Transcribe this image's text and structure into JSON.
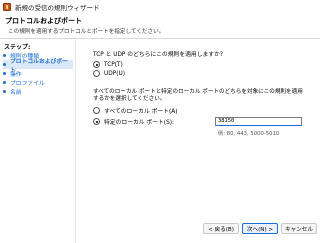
{
  "window": {
    "title": "新規の受信の規則ウィザード"
  },
  "header": {
    "title": "プロトコルおよびポート",
    "description": "この規則を適用するプロトコルとポートを指定してください。"
  },
  "sidebar": {
    "title": "ステップ:",
    "items": [
      {
        "label": "規則の種類",
        "state": "done"
      },
      {
        "label": "プロトコルおよびポート",
        "state": "current"
      },
      {
        "label": "操作",
        "state": "pending"
      },
      {
        "label": "プロファイル",
        "state": "pending"
      },
      {
        "label": "名前",
        "state": "pending"
      }
    ]
  },
  "protocol": {
    "question": "TCP と UDP のどちらにこの規則を適用しますか?",
    "options": [
      {
        "label": "TCP(T)",
        "checked": true
      },
      {
        "label": "UDP(U)",
        "checked": false
      }
    ]
  },
  "ports": {
    "question": "すべてのローカル ポートと特定のローカル ポートのどちらを対象にこの規則を適用するかを選択してください。",
    "options": [
      {
        "label": "すべてのローカル ポート(A)",
        "checked": false
      },
      {
        "label": "特定のローカル ポート(S):",
        "checked": true
      }
    ],
    "value": "38150",
    "example": "例: 80, 443, 5000-5010"
  },
  "buttons": {
    "back": "< 戻る(B)",
    "next": "次へ(N) >",
    "cancel": "キャンセル"
  },
  "colors": {
    "accent": "#1a6fd1",
    "selection": "#dbe8f7"
  }
}
